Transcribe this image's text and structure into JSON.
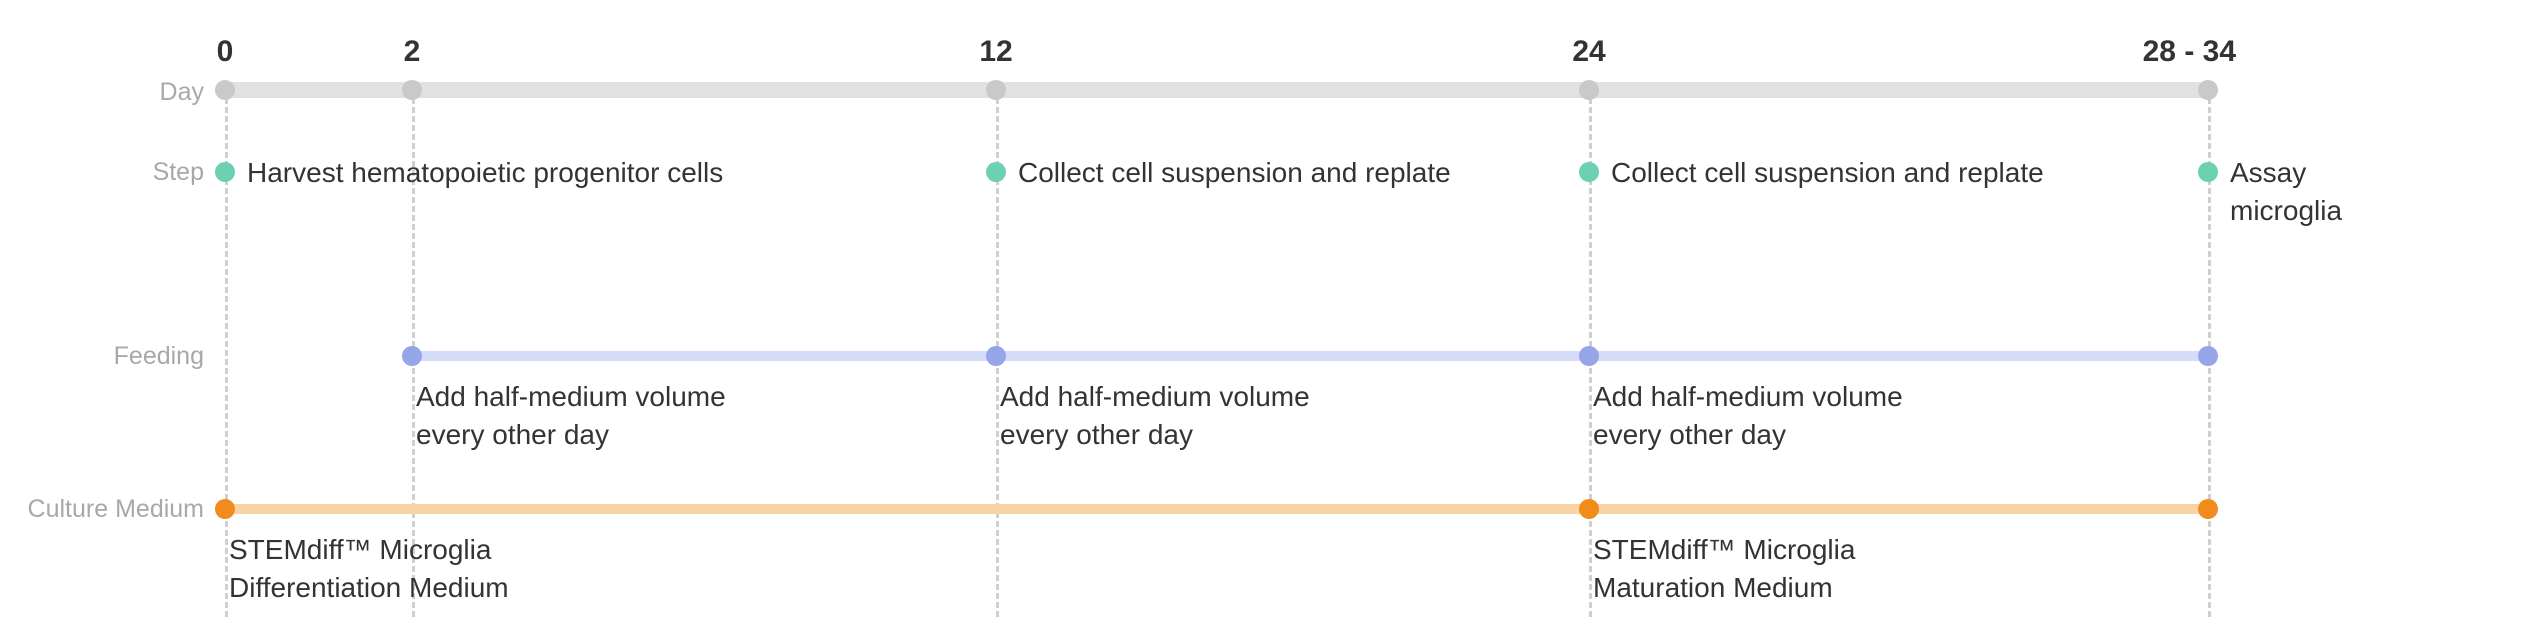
{
  "labels": {
    "day": "Day",
    "step": "Step",
    "feeding": "Feeding",
    "culture_medium": "Culture Medium"
  },
  "days": [
    "0",
    "2",
    "12",
    "24",
    "28 - 34"
  ],
  "steps": [
    "Harvest hematopoietic progenitor cells",
    "Collect cell suspension and replate",
    "Collect cell suspension and replate",
    "Assay\nmicroglia"
  ],
  "feeding": [
    "Add half-medium volume\nevery other day",
    "Add half-medium volume\nevery other day",
    "Add half-medium volume\nevery other day"
  ],
  "culture_medium": [
    "STEMdiff™ Microglia\nDifferentiation Medium",
    "STEMdiff™ Microglia\nMaturation Medium"
  ],
  "chart_data": {
    "type": "timeline",
    "x_unit": "day",
    "ticks": [
      0,
      2,
      12,
      24,
      "28-34"
    ],
    "rows": [
      {
        "name": "Step",
        "type": "point-events",
        "events": [
          {
            "day": 0,
            "label": "Harvest hematopoietic progenitor cells"
          },
          {
            "day": 12,
            "label": "Collect cell suspension and replate"
          },
          {
            "day": 24,
            "label": "Collect cell suspension and replate"
          },
          {
            "day": "28-34",
            "label": "Assay microglia"
          }
        ],
        "color": "#6cd1b2"
      },
      {
        "name": "Feeding",
        "type": "interval-with-notes",
        "span": [
          2,
          "28-34"
        ],
        "notes": [
          {
            "from": 2,
            "to": 12,
            "label": "Add half-medium volume every other day"
          },
          {
            "from": 12,
            "to": 24,
            "label": "Add half-medium volume every other day"
          },
          {
            "from": 24,
            "to": "28-34",
            "label": "Add half-medium volume every other day"
          }
        ],
        "color": "#96a4e8"
      },
      {
        "name": "Culture Medium",
        "type": "interval-with-notes",
        "span": [
          0,
          "28-34"
        ],
        "notes": [
          {
            "from": 0,
            "to": 24,
            "label": "STEMdiff™ Microglia Differentiation Medium"
          },
          {
            "from": 24,
            "to": "28-34",
            "label": "STEMdiff™ Microglia Maturation Medium"
          }
        ],
        "color": "#f18b1c"
      }
    ]
  },
  "colors": {
    "step_dot": "#6cd1b2",
    "feed_dot": "#96a4e8",
    "feed_bar": "#d6dcf7",
    "cm_dot": "#f18b1c",
    "cm_bar": "#f8d4a5",
    "day_bar": "#e1e1e1",
    "day_dot": "#c9c9c9",
    "text": "#333333",
    "label_muted": "#a8a8a8"
  }
}
